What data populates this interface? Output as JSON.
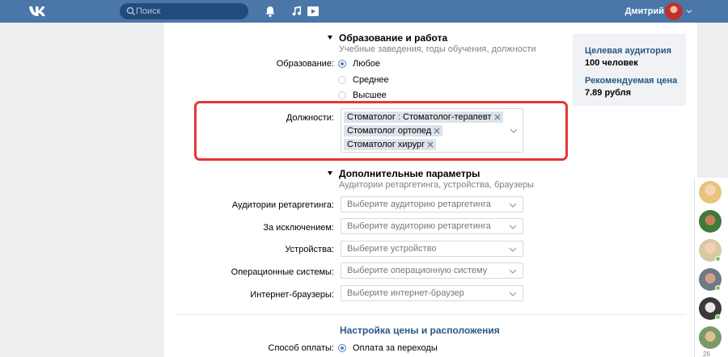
{
  "header": {
    "search_placeholder": "Поиск",
    "user_name": "Дмитрий"
  },
  "education": {
    "title": "Образование и работа",
    "subtitle": "Учебные заведения, годы обучения, должности",
    "label": "Образование:",
    "options": [
      {
        "label": "Любое",
        "selected": true
      },
      {
        "label": "Среднее",
        "selected": false
      },
      {
        "label": "Высшее",
        "selected": false
      }
    ],
    "positions_label": "Должности:",
    "positions": [
      "Стоматолог",
      "Стоматолог-терапевт",
      "Стоматолог ортопед",
      "Стоматолог хирург"
    ]
  },
  "extra": {
    "title": "Дополнительные параметры",
    "subtitle": "Аудитории ретаргетинга, устройства, браузеры",
    "fields": [
      {
        "label": "Аудитории ретаргетинга:",
        "placeholder": "Выберите аудиторию ретаргетинга"
      },
      {
        "label": "За исключением:",
        "placeholder": "Выберите аудиторию ретаргетинга"
      },
      {
        "label": "Устройства:",
        "placeholder": "Выберите устройство"
      },
      {
        "label": "Операционные системы:",
        "placeholder": "Выберите операционную систему"
      },
      {
        "label": "Интернет-браузеры:",
        "placeholder": "Выберите интернет-браузер"
      }
    ]
  },
  "pricing": {
    "title": "Настройка цены и расположения",
    "payment_label": "Способ оплаты:",
    "payment_option": "Оплата за переходы"
  },
  "info": {
    "audience_title": "Целевая аудитория",
    "audience_value": "100 человек",
    "price_title": "Рекомендуемая цена",
    "price_value": "7.89 рубля"
  },
  "friends": {
    "count": "26"
  },
  "colors": {
    "header": "#4a76a8",
    "accent": "#5181b8",
    "highlight": "#e63535"
  }
}
